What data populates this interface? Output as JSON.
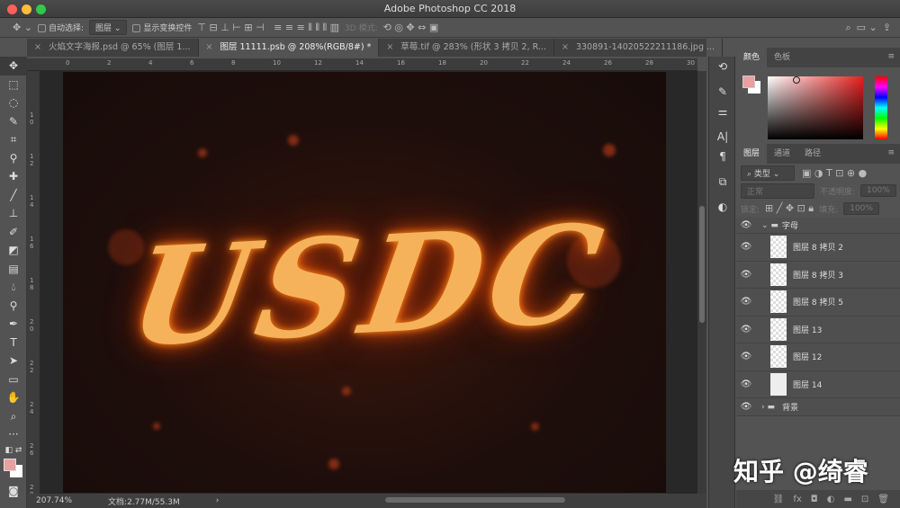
{
  "window": {
    "title": "Adobe Photoshop CC 2018"
  },
  "options_bar": {
    "auto_select_label": "自动选择:",
    "auto_select_value": "图层",
    "show_transform_label": "显示变换控件",
    "mode_3d": "3D 模式:"
  },
  "tabs": [
    {
      "label": "火焰文字海报.psd @ 65% (图层 1...",
      "active": false
    },
    {
      "label": "图层 11111.psb @ 208%(RGB/8#) *",
      "active": true
    },
    {
      "label": "草莓.tif @ 283% (形状 3 拷贝 2, R...",
      "active": false
    },
    {
      "label": "330891-14020522211186.jpg ...",
      "active": false
    }
  ],
  "ruler": {
    "top": [
      "0",
      "2",
      "4",
      "6",
      "8",
      "10",
      "12",
      "14",
      "16",
      "18",
      "20",
      "22",
      "24",
      "26",
      "28",
      "30"
    ],
    "left": [
      "10",
      "12",
      "14",
      "16",
      "18",
      "20",
      "22",
      "24",
      "26",
      "28"
    ]
  },
  "canvas": {
    "art_text": "USDC"
  },
  "status": {
    "zoom": "207.74%",
    "doc": "文档:2.77M/55.3M",
    "arrow": "›"
  },
  "color_panel": {
    "tabs": [
      "颜色",
      "色板"
    ],
    "foreground": "#e8a0a0",
    "background": "#ffffff"
  },
  "layers_panel": {
    "tabs": [
      "图层",
      "通道",
      "路径"
    ],
    "filter": "类型",
    "blend_mode": "正常",
    "opacity_label": "不透明度:",
    "opacity": "100%",
    "lock_label": "锁定:",
    "fill_label": "填充:",
    "fill": "100%",
    "group": "字母",
    "layers": [
      "图层 8 拷贝 2",
      "图层 8 拷贝 3",
      "图层 8 拷贝 5",
      "图层 13",
      "图层 12",
      "图层 14"
    ],
    "bg_group": "背景"
  },
  "watermark": "知乎 @绮睿"
}
